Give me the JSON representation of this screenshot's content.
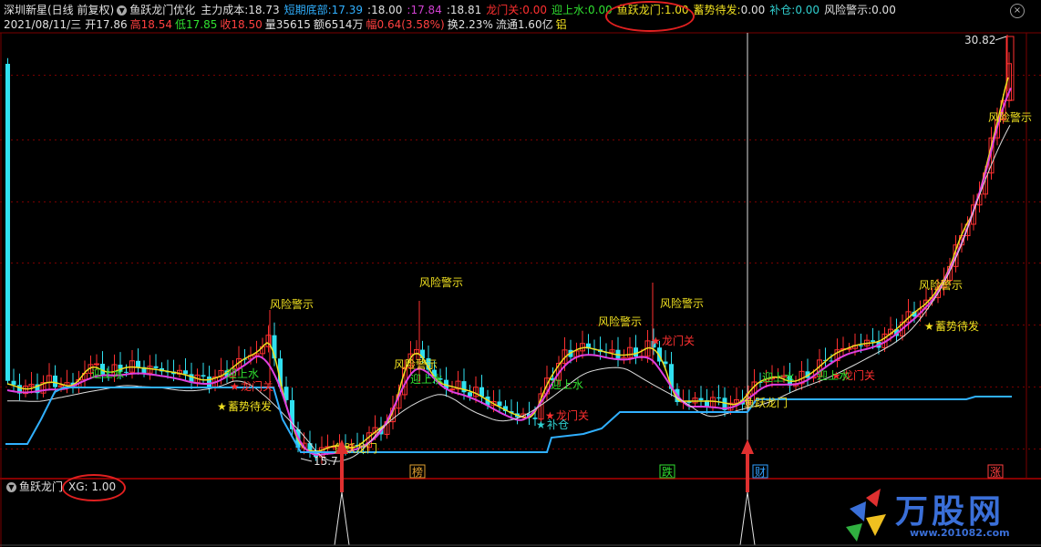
{
  "header": {
    "stock": "深圳新星(日线 前复权)",
    "indicator": "鱼跃龙门优化",
    "items": [
      {
        "label": "主力成本:",
        "value": "18.73",
        "color": "#e0e0e0",
        "vcolor": "#e0e0e0"
      },
      {
        "label": "短期底部:",
        "value": "17.39",
        "color": "#30b0ff",
        "vcolor": "#30b0ff"
      },
      {
        "label": ":",
        "value": "18.00",
        "color": "#e0e0e0",
        "vcolor": "#e0e0e0"
      },
      {
        "label": ":",
        "value": "17.84",
        "color": "#d040d0",
        "vcolor": "#d040d0"
      },
      {
        "label": ":",
        "value": "18.81",
        "color": "#e0e0e0",
        "vcolor": "#e0e0e0"
      },
      {
        "label": "龙门关:",
        "value": "0.00",
        "color": "#ff3030",
        "vcolor": "#ff3030"
      },
      {
        "label": "迎上水:",
        "value": "0.00",
        "color": "#30e030",
        "vcolor": "#30e030"
      },
      {
        "label": "鱼跃龙门:",
        "value": "1.00",
        "color": "#f0e020",
        "vcolor": "#f0e020"
      },
      {
        "label": "蓄势待发:",
        "value": "0.00",
        "color": "#f0e020",
        "vcolor": "#e0e0e0"
      },
      {
        "label": "补仓:",
        "value": "0.00",
        "color": "#30d0d0",
        "vcolor": "#30d0d0"
      },
      {
        "label": "风险警示:",
        "value": "0.00",
        "color": "#e0e0e0",
        "vcolor": "#e0e0e0"
      }
    ]
  },
  "info": {
    "date": "2021/08/11/三",
    "items": [
      {
        "label": "开",
        "value": "17.86",
        "color": "#e0e0e0"
      },
      {
        "label": "高",
        "value": "18.54",
        "color": "#ff4040"
      },
      {
        "label": "低",
        "value": "17.85",
        "color": "#30e030"
      },
      {
        "label": "收",
        "value": "18.50",
        "color": "#ff4040"
      },
      {
        "label": "量",
        "value": "35615",
        "color": "#e0e0e0"
      },
      {
        "label": "额",
        "value": "6514万",
        "color": "#e0e0e0"
      },
      {
        "label": "幅",
        "value": "0.64(3.58%)",
        "color": "#ff4040"
      },
      {
        "label": "换",
        "value": "2.23%",
        "color": "#e0e0e0"
      },
      {
        "label": "流通",
        "value": "1.60亿",
        "color": "#e0e0e0"
      },
      {
        "label": "",
        "value": "铝",
        "color": "#f0e020"
      }
    ]
  },
  "chart_data": {
    "type": "candlestick",
    "max_label": "30.82",
    "min_label": "15.7",
    "signals": {
      "risk": "风险警示",
      "dragon_gate": "龙门关",
      "up_water": "迎上水",
      "build_up": "蓄势待发",
      "add_pos": "补仓",
      "fish_jump": "鱼跃龙门"
    },
    "tags": [
      {
        "label": "榜",
        "color": "#e0a030"
      },
      {
        "label": "跌",
        "color": "#30e030"
      },
      {
        "label": "财",
        "color": "#30a0ff"
      },
      {
        "label": "涨",
        "color": "#ff4040"
      }
    ]
  },
  "sub": {
    "name": "鱼跃龙门",
    "xg_label": "XG: 1.00"
  },
  "logo": {
    "text": "万股网",
    "url": "www.201082.com"
  },
  "colors": {
    "up": "#ff3030",
    "down": "#30e0f0",
    "ma_fast": "#f0e020",
    "ma_mid": "#e040e0",
    "ma_slow": "#dddddd",
    "bottom": "#30b0ff",
    "grid": "#7a0000"
  }
}
